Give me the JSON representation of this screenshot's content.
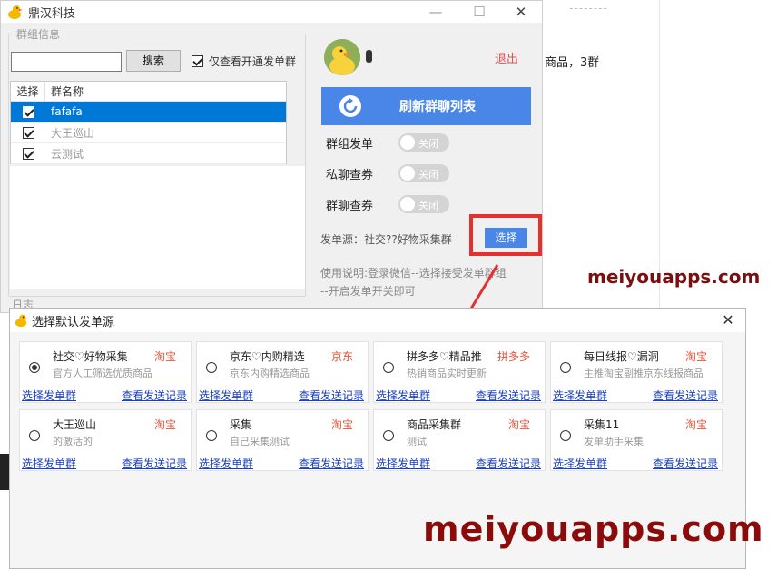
{
  "background": {
    "fragment_text": "商品，3群"
  },
  "main_window": {
    "title": "鼎汉科技",
    "min_glyph": "—",
    "max_glyph": "☐",
    "close_glyph": "✕",
    "group_legend": "群组信息",
    "search_placeholder": "",
    "search_button": "搜索",
    "only_open_label": "仅查看开通发单群",
    "table": {
      "headers": [
        "选择",
        "群名称"
      ],
      "rows": [
        {
          "name": "fafafa",
          "checked": true,
          "selected": true
        },
        {
          "name": "大王巡山",
          "checked": true,
          "selected": false
        },
        {
          "name": "云测试",
          "checked": true,
          "selected": false
        }
      ]
    },
    "log_label": "日志",
    "logout": "退出",
    "refresh_button": "刷新群聊列表",
    "toggles": [
      {
        "label": "群组发单",
        "state": "关闭"
      },
      {
        "label": "私聊查券",
        "state": "关闭"
      },
      {
        "label": "群聊查券",
        "state": "关闭"
      }
    ],
    "source_label": "发单源：",
    "source_value": "社交??好物采集群",
    "choose_button": "选择",
    "usage_line1": "使用说明:登录微信--选择接受发单群组",
    "usage_line2": "--开启发单开关即可"
  },
  "watermark": "meiyouapps.com",
  "dialog": {
    "title": "选择默认发单源",
    "close_glyph": "✕",
    "link_select": "选择发单群",
    "link_records": "查看发送记录",
    "cards": [
      {
        "name": "社交♡好物采集",
        "platform": "淘宝",
        "desc": "官方人工筛选优质商品",
        "selected": true
      },
      {
        "name": "京东♡内购精选",
        "platform": "京东",
        "desc": "京东内购精选商品",
        "selected": false
      },
      {
        "name": "拼多多♡精品推",
        "platform": "拼多多",
        "desc": "热销商品实时更新",
        "selected": false
      },
      {
        "name": "每日线报♡漏洞",
        "platform": "淘宝",
        "desc": "主推淘宝副推京东线报商品",
        "selected": false
      },
      {
        "name": "大王巡山",
        "platform": "淘宝",
        "desc": "的激活的",
        "selected": false
      },
      {
        "name": "采集",
        "platform": "淘宝",
        "desc": "自己采集测试",
        "selected": false
      },
      {
        "name": "商品采集群",
        "platform": "淘宝",
        "desc": "测试",
        "selected": false
      },
      {
        "name": "采集11",
        "platform": "淘宝",
        "desc": "发单助手采集",
        "selected": false
      }
    ]
  }
}
